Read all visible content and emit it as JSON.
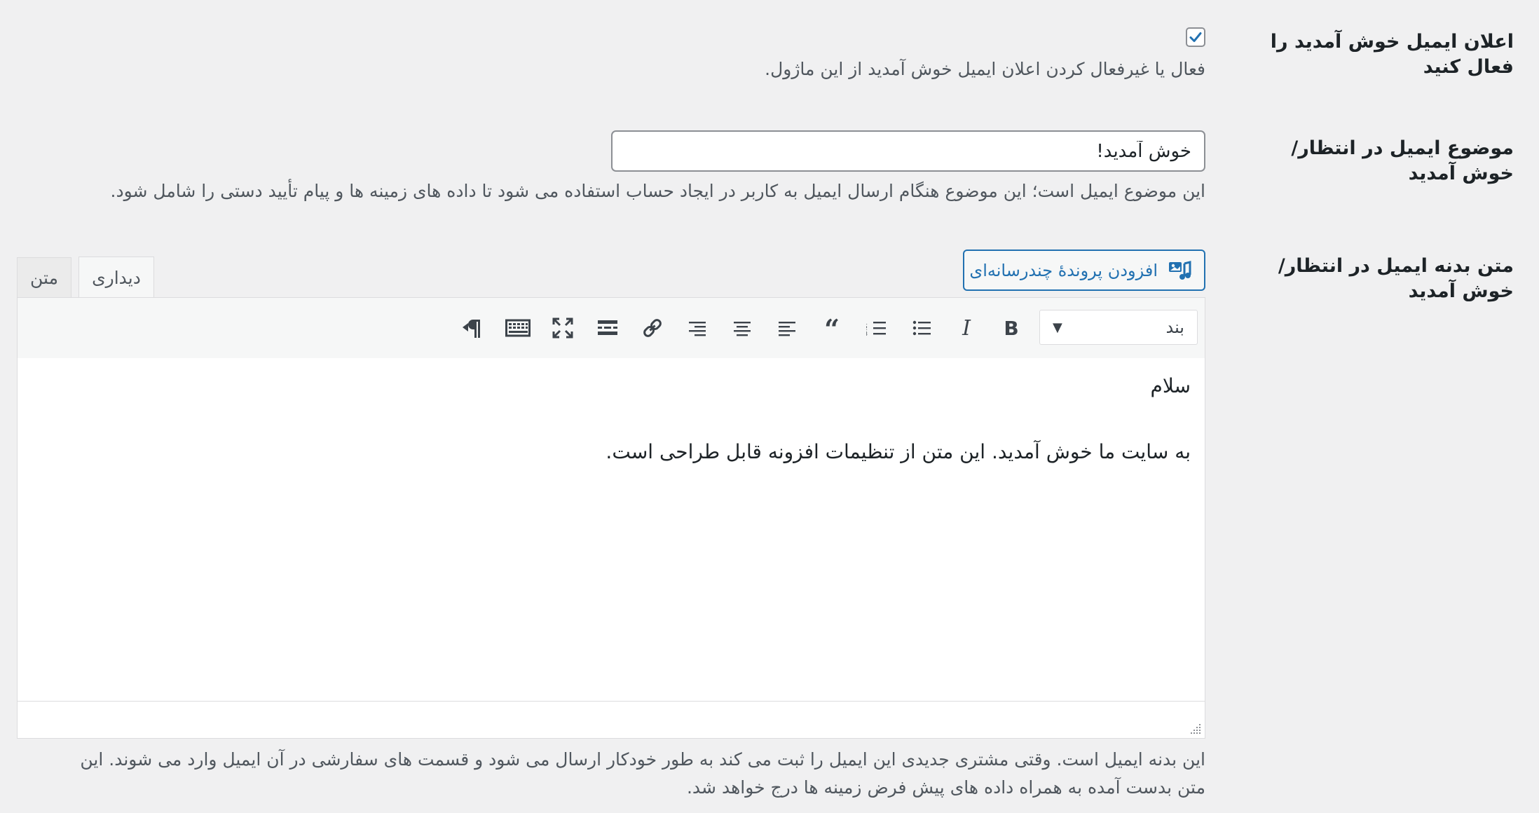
{
  "enable_row": {
    "label": "اعلان ایمیل خوش آمدید را فعال کنید",
    "checked": true,
    "description": "فعال یا غیرفعال کردن اعلان ایمیل خوش آمدید از این ماژول."
  },
  "subject_row": {
    "label": "موضوع ایمیل در انتظار/خوش آمدید",
    "value": "خوش آمدید!",
    "description": "این موضوع ایمیل است؛ این موضوع هنگام ارسال ایمیل به کاربر در ایجاد حساب استفاده می شود تا داده های زمینه ها و پیام تأیید دستی را شامل شود."
  },
  "body_row": {
    "label": "متن بدنه ایمیل در انتظار/خوش آمدید",
    "add_media_label": "افزودن پروندهٔ چندرسانه‌ای",
    "tabs": {
      "visual": "دیداری",
      "text": "متن"
    },
    "format_select": "بند",
    "toolbar_icons": [
      "bold-icon",
      "italic-icon",
      "bullet-list-icon",
      "numbered-list-icon",
      "blockquote-icon",
      "align-left-icon",
      "align-center-icon",
      "align-right-icon",
      "link-icon",
      "read-more-icon",
      "fullscreen-icon",
      "toolbar-toggle-icon",
      "text-direction-icon"
    ],
    "content": {
      "line1": "سلام",
      "line2": "به سایت ما خوش آمدید. این متن از تنظیمات افزونه قابل طراحی است."
    },
    "description_line1": "این بدنه ایمیل است. وقتی مشتری جدیدی این ایمیل را ثبت می کند به طور خودکار ارسال می شود و قسمت های سفارشی در آن ایمیل وارد می شوند. این",
    "description_line2": "متن بدست آمده به همراه داده های پیش فرض زمینه ها درج خواهد شد."
  },
  "colors": {
    "accent": "#2271b1",
    "background": "#f0f0f1",
    "text": "#1d2327",
    "muted": "#50575e"
  }
}
